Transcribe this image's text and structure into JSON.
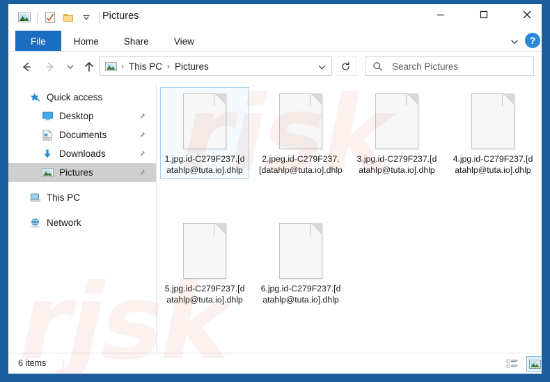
{
  "window": {
    "title": "Pictures",
    "quick_access_icons": [
      "pictures-icon",
      "properties-checkmark-icon",
      "new-folder-icon",
      "customize-chevron-icon"
    ],
    "controls": {
      "minimize": "minimize-icon",
      "maximize": "maximize-icon",
      "close": "close-icon"
    }
  },
  "ribbon": {
    "tabs": [
      {
        "label": "File",
        "active": true
      },
      {
        "label": "Home",
        "active": false
      },
      {
        "label": "Share",
        "active": false
      },
      {
        "label": "View",
        "active": false
      }
    ],
    "collapse_icon": "chevron-down-icon",
    "help_label": "?"
  },
  "navigation": {
    "back_icon": "arrow-left-icon",
    "forward_icon": "arrow-right-icon",
    "recent_icon": "chevron-down-icon",
    "up_icon": "arrow-up-icon",
    "refresh_icon": "refresh-icon",
    "breadcrumb": {
      "icon": "pictures-folder-icon",
      "parts": [
        "This PC",
        "Pictures"
      ],
      "separator": "›",
      "dropdown_icon": "chevron-down-icon"
    }
  },
  "search": {
    "icon": "search-icon",
    "placeholder": "Search Pictures",
    "value": ""
  },
  "sidebar": {
    "items": [
      {
        "label": "Quick access",
        "icon": "star-pin-icon",
        "level": 0,
        "pinned": false,
        "selected": false
      },
      {
        "label": "Desktop",
        "icon": "desktop-icon",
        "level": 1,
        "pinned": true,
        "selected": false
      },
      {
        "label": "Documents",
        "icon": "documents-icon",
        "level": 1,
        "pinned": true,
        "selected": false
      },
      {
        "label": "Downloads",
        "icon": "downloads-icon",
        "level": 1,
        "pinned": true,
        "selected": false
      },
      {
        "label": "Pictures",
        "icon": "pictures-icon",
        "level": 1,
        "pinned": true,
        "selected": true
      },
      {
        "label": "This PC",
        "icon": "this-pc-icon",
        "level": 0,
        "pinned": false,
        "selected": false
      },
      {
        "label": "Network",
        "icon": "network-icon",
        "level": 0,
        "pinned": false,
        "selected": false
      }
    ]
  },
  "files": [
    {
      "name": "1.jpg.id-C279F237.[datahlp@tuta.io].dhlp",
      "selected": true
    },
    {
      "name": "2.jpeg.id-C279F237.[datahlp@tuta.io].dhlp",
      "selected": false
    },
    {
      "name": "3.jpg.id-C279F237.[datahlp@tuta.io].dhlp",
      "selected": false
    },
    {
      "name": "4.jpg.id-C279F237.[datahlp@tuta.io].dhlp",
      "selected": false
    },
    {
      "name": "5.jpg.id-C279F237.[datahlp@tuta.io].dhlp",
      "selected": false
    },
    {
      "name": "6.jpg.id-C279F237.[datahlp@tuta.io].dhlp",
      "selected": false
    }
  ],
  "status": {
    "item_count": "6 items",
    "view_details_icon": "details-view-icon",
    "view_icons_icon": "large-icons-view-icon"
  },
  "watermark": {
    "line1": "risk",
    "line2": "rjsk"
  },
  "colors": {
    "frame_blue": "#1b5e9e",
    "tab_active": "#1b6dc1",
    "help_blue": "#2b88d8",
    "selection_border": "#a8d2f0",
    "sidebar_selected": "#cfcfcf"
  }
}
